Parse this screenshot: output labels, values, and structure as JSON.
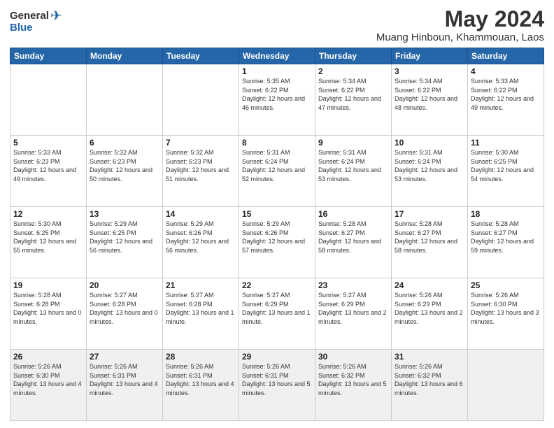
{
  "header": {
    "logo": {
      "general": "General",
      "blue": "Blue"
    },
    "title": "May 2024",
    "location": "Muang Hinboun, Khammouan, Laos"
  },
  "weekdays": [
    "Sunday",
    "Monday",
    "Tuesday",
    "Wednesday",
    "Thursday",
    "Friday",
    "Saturday"
  ],
  "weeks": [
    [
      {
        "day": "",
        "sunrise": "",
        "sunset": "",
        "daylight": ""
      },
      {
        "day": "",
        "sunrise": "",
        "sunset": "",
        "daylight": ""
      },
      {
        "day": "",
        "sunrise": "",
        "sunset": "",
        "daylight": ""
      },
      {
        "day": "1",
        "sunrise": "Sunrise: 5:35 AM",
        "sunset": "Sunset: 6:22 PM",
        "daylight": "Daylight: 12 hours and 46 minutes."
      },
      {
        "day": "2",
        "sunrise": "Sunrise: 5:34 AM",
        "sunset": "Sunset: 6:22 PM",
        "daylight": "Daylight: 12 hours and 47 minutes."
      },
      {
        "day": "3",
        "sunrise": "Sunrise: 5:34 AM",
        "sunset": "Sunset: 6:22 PM",
        "daylight": "Daylight: 12 hours and 48 minutes."
      },
      {
        "day": "4",
        "sunrise": "Sunrise: 5:33 AM",
        "sunset": "Sunset: 6:22 PM",
        "daylight": "Daylight: 12 hours and 49 minutes."
      }
    ],
    [
      {
        "day": "5",
        "sunrise": "Sunrise: 5:33 AM",
        "sunset": "Sunset: 6:23 PM",
        "daylight": "Daylight: 12 hours and 49 minutes."
      },
      {
        "day": "6",
        "sunrise": "Sunrise: 5:32 AM",
        "sunset": "Sunset: 6:23 PM",
        "daylight": "Daylight: 12 hours and 50 minutes."
      },
      {
        "day": "7",
        "sunrise": "Sunrise: 5:32 AM",
        "sunset": "Sunset: 6:23 PM",
        "daylight": "Daylight: 12 hours and 51 minutes."
      },
      {
        "day": "8",
        "sunrise": "Sunrise: 5:31 AM",
        "sunset": "Sunset: 6:24 PM",
        "daylight": "Daylight: 12 hours and 52 minutes."
      },
      {
        "day": "9",
        "sunrise": "Sunrise: 5:31 AM",
        "sunset": "Sunset: 6:24 PM",
        "daylight": "Daylight: 12 hours and 53 minutes."
      },
      {
        "day": "10",
        "sunrise": "Sunrise: 5:31 AM",
        "sunset": "Sunset: 6:24 PM",
        "daylight": "Daylight: 12 hours and 53 minutes."
      },
      {
        "day": "11",
        "sunrise": "Sunrise: 5:30 AM",
        "sunset": "Sunset: 6:25 PM",
        "daylight": "Daylight: 12 hours and 54 minutes."
      }
    ],
    [
      {
        "day": "12",
        "sunrise": "Sunrise: 5:30 AM",
        "sunset": "Sunset: 6:25 PM",
        "daylight": "Daylight: 12 hours and 55 minutes."
      },
      {
        "day": "13",
        "sunrise": "Sunrise: 5:29 AM",
        "sunset": "Sunset: 6:25 PM",
        "daylight": "Daylight: 12 hours and 56 minutes."
      },
      {
        "day": "14",
        "sunrise": "Sunrise: 5:29 AM",
        "sunset": "Sunset: 6:26 PM",
        "daylight": "Daylight: 12 hours and 56 minutes."
      },
      {
        "day": "15",
        "sunrise": "Sunrise: 5:29 AM",
        "sunset": "Sunset: 6:26 PM",
        "daylight": "Daylight: 12 hours and 57 minutes."
      },
      {
        "day": "16",
        "sunrise": "Sunrise: 5:28 AM",
        "sunset": "Sunset: 6:27 PM",
        "daylight": "Daylight: 12 hours and 58 minutes."
      },
      {
        "day": "17",
        "sunrise": "Sunrise: 5:28 AM",
        "sunset": "Sunset: 6:27 PM",
        "daylight": "Daylight: 12 hours and 58 minutes."
      },
      {
        "day": "18",
        "sunrise": "Sunrise: 5:28 AM",
        "sunset": "Sunset: 6:27 PM",
        "daylight": "Daylight: 12 hours and 59 minutes."
      }
    ],
    [
      {
        "day": "19",
        "sunrise": "Sunrise: 5:28 AM",
        "sunset": "Sunset: 6:28 PM",
        "daylight": "Daylight: 13 hours and 0 minutes."
      },
      {
        "day": "20",
        "sunrise": "Sunrise: 5:27 AM",
        "sunset": "Sunset: 6:28 PM",
        "daylight": "Daylight: 13 hours and 0 minutes."
      },
      {
        "day": "21",
        "sunrise": "Sunrise: 5:27 AM",
        "sunset": "Sunset: 6:28 PM",
        "daylight": "Daylight: 13 hours and 1 minute."
      },
      {
        "day": "22",
        "sunrise": "Sunrise: 5:27 AM",
        "sunset": "Sunset: 6:29 PM",
        "daylight": "Daylight: 13 hours and 1 minute."
      },
      {
        "day": "23",
        "sunrise": "Sunrise: 5:27 AM",
        "sunset": "Sunset: 6:29 PM",
        "daylight": "Daylight: 13 hours and 2 minutes."
      },
      {
        "day": "24",
        "sunrise": "Sunrise: 5:26 AM",
        "sunset": "Sunset: 6:29 PM",
        "daylight": "Daylight: 13 hours and 2 minutes."
      },
      {
        "day": "25",
        "sunrise": "Sunrise: 5:26 AM",
        "sunset": "Sunset: 6:30 PM",
        "daylight": "Daylight: 13 hours and 3 minutes."
      }
    ],
    [
      {
        "day": "26",
        "sunrise": "Sunrise: 5:26 AM",
        "sunset": "Sunset: 6:30 PM",
        "daylight": "Daylight: 13 hours and 4 minutes."
      },
      {
        "day": "27",
        "sunrise": "Sunrise: 5:26 AM",
        "sunset": "Sunset: 6:31 PM",
        "daylight": "Daylight: 13 hours and 4 minutes."
      },
      {
        "day": "28",
        "sunrise": "Sunrise: 5:26 AM",
        "sunset": "Sunset: 6:31 PM",
        "daylight": "Daylight: 13 hours and 4 minutes."
      },
      {
        "day": "29",
        "sunrise": "Sunrise: 5:26 AM",
        "sunset": "Sunset: 6:31 PM",
        "daylight": "Daylight: 13 hours and 5 minutes."
      },
      {
        "day": "30",
        "sunrise": "Sunrise: 5:26 AM",
        "sunset": "Sunset: 6:32 PM",
        "daylight": "Daylight: 13 hours and 5 minutes."
      },
      {
        "day": "31",
        "sunrise": "Sunrise: 5:26 AM",
        "sunset": "Sunset: 6:32 PM",
        "daylight": "Daylight: 13 hours and 6 minutes."
      },
      {
        "day": "",
        "sunrise": "",
        "sunset": "",
        "daylight": ""
      }
    ]
  ]
}
